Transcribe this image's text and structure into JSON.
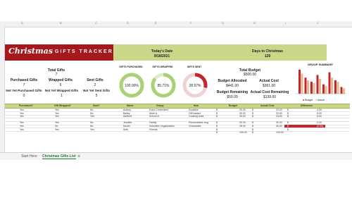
{
  "title": {
    "script": "Christmas",
    "rest": "GIFTS TRACKER"
  },
  "header": {
    "todays_date_label": "Today's Date",
    "todays_date_value": "9/18/2021",
    "days_label": "Days to Christmas",
    "days_value": "129"
  },
  "summary": {
    "total_gifts_label": "Total Gifts",
    "total_gifts_value": "7",
    "purchased_label": "Purchased Gifts",
    "purchased_value": "7",
    "wrapped_label": "Wrapped Gifts",
    "wrapped_value": "6",
    "sent_label": "Sent Gifts",
    "sent_value": "2",
    "not_purchased_label": "Not Yet Purchased Gifts",
    "not_purchased_value": "0",
    "not_wrapped_label": "Not Yet Wrapped Gifts",
    "not_wrapped_value": "1",
    "not_sent_label": "Not Yet Sent Gifts",
    "not_sent_value": "5"
  },
  "donuts": [
    {
      "label": "GIFTS PURCHASED",
      "value_text": "100.00%",
      "fraction": 1.0,
      "color": "#a9d176",
      "track": "#dbeec8"
    },
    {
      "label": "GIFTS WRAPPED",
      "value_text": "85.71%",
      "fraction": 0.8571,
      "color": "#a9d176",
      "track": "#dbeec8"
    },
    {
      "label": "GIFTS SENT",
      "value_text": "28.57%",
      "fraction": 0.2857,
      "color": "#c0282c",
      "track": "#f1d2d2"
    }
  ],
  "budget": {
    "total_label": "Total Budget",
    "total_value": "$500.00",
    "allocated_label": "Budget Allocated",
    "allocated_value": "$441.00",
    "actual_label": "Actual Cost",
    "actual_value": "$361.00",
    "remaining_label": "Budget Remaining",
    "remaining_value": "$59.00",
    "actual_remaining_label": "Actual Cost Remaining",
    "actual_remaining_value": "$139.00"
  },
  "group_summary": {
    "title": "GROUP SUMMARY",
    "legend_budget": "Budget",
    "legend_actual": "Actual",
    "color_budget": "#c0282c",
    "color_actual": "#e8b78f",
    "budget": [
      0.9,
      0.6,
      0.45,
      0.7,
      0.35,
      0.8,
      0.5,
      0.25
    ],
    "actual": [
      0.75,
      0.5,
      0.4,
      0.55,
      0.3,
      0.6,
      0.45,
      0.2
    ]
  },
  "table": {
    "headers": [
      "Purchased?",
      "Gift Wrapped?",
      "Sent?",
      "Name",
      "Group",
      "Item",
      "Budget",
      "Actual Cost",
      "Difference"
    ],
    "rows": [
      [
        "Yes",
        "Yes",
        "No",
        "Audrey",
        "Extra Commuters",
        "Scrabble",
        "$",
        "20.00",
        "$",
        "22.00",
        "$",
        "4.00"
      ],
      [
        "Yes",
        "Yes",
        "No",
        "Bailey",
        "Work A",
        "Gift basket",
        "$",
        "30.00",
        "$",
        "22.00",
        "$",
        "8.00"
      ],
      [
        "Yes",
        "Yes",
        "Yes",
        "Ashford",
        "School A",
        "Cooking tools",
        "$",
        "30.00",
        "$",
        "24.00",
        "$",
        "6.00"
      ],
      [
        "",
        "",
        "",
        "",
        "",
        "",
        "",
        "",
        "",
        "",
        "",
        ""
      ],
      [
        "Yes",
        "Yes",
        "No",
        "Jennifer",
        "Family",
        "Personalized mug",
        "$",
        "30.00",
        "$",
        "30.00",
        "$",
        "0.00"
      ],
      [
        "Yes",
        "No",
        "No",
        "Norah",
        "Volunteer Organization",
        "Chocolates",
        "$",
        "28.00",
        "$",
        "30.00",
        "$",
        "(2.00)"
      ],
      [
        "Yes",
        "Yes",
        "Yes",
        "Seth",
        "Friends",
        "",
        "$",
        "",
        "$",
        "",
        "$",
        ""
      ]
    ],
    "total_budget": "100.00",
    "total_actual": "100.00"
  },
  "tabs": [
    "Start Here",
    "Christmas Gifts List"
  ]
}
